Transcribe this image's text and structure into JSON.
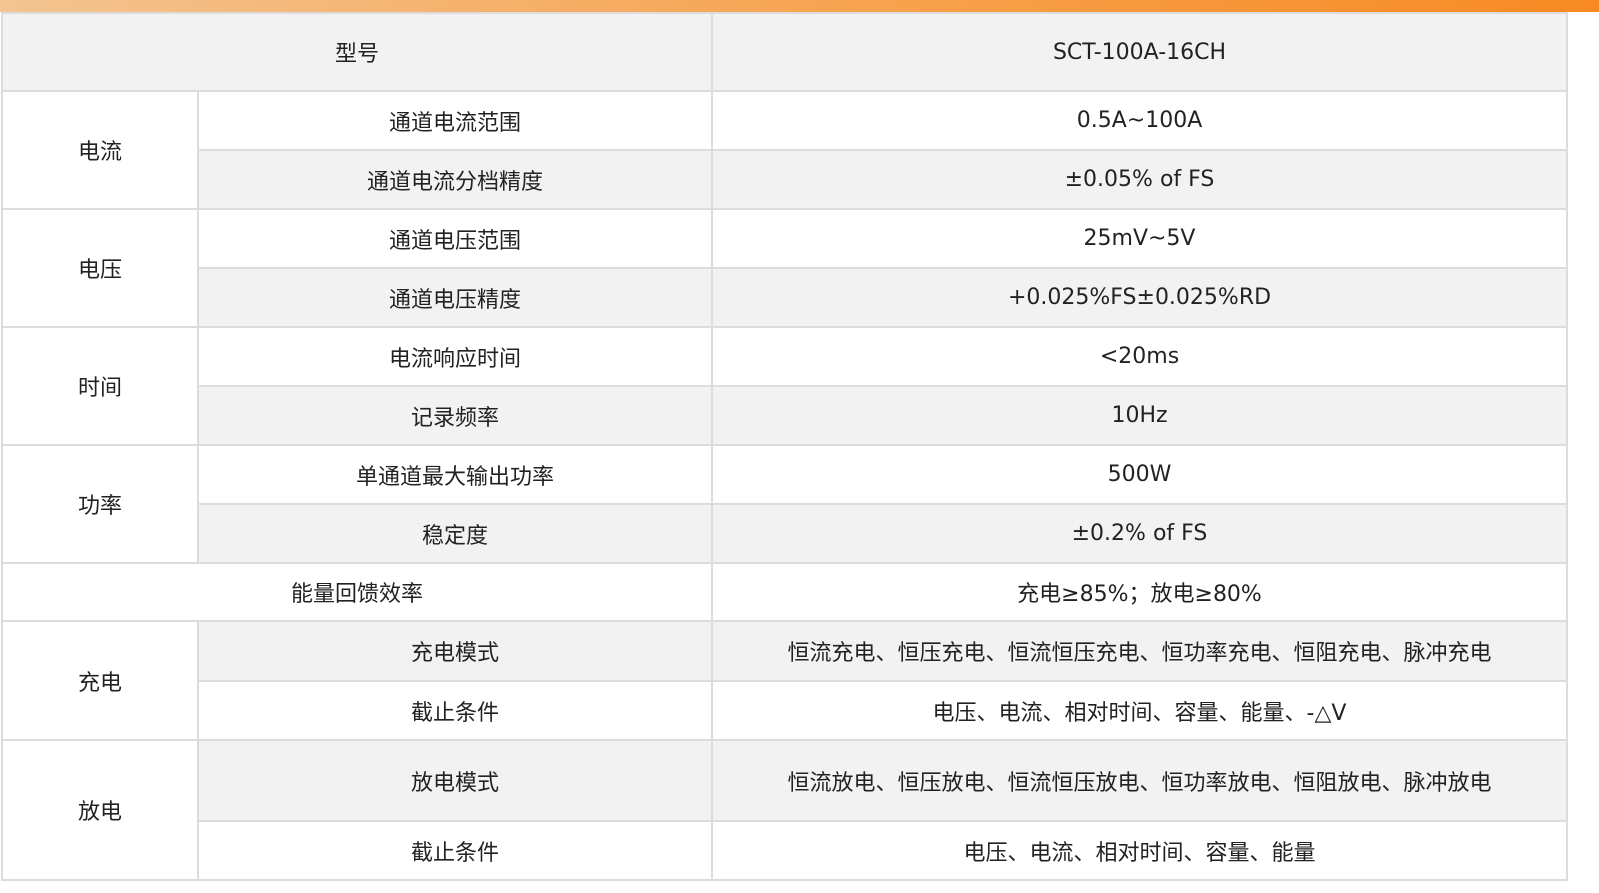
{
  "header": {
    "label": "型号",
    "value": "SCT-100A-16CH"
  },
  "groups": {
    "current": {
      "name": "电流",
      "rows": [
        {
          "label": "通道电流范围",
          "value": "0.5A~100A"
        },
        {
          "label": "通道电流分档精度",
          "value": "±0.05% of FS"
        }
      ]
    },
    "voltage": {
      "name": "电压",
      "rows": [
        {
          "label": "通道电压范围",
          "value": "25mV~5V"
        },
        {
          "label": "通道电压精度",
          "value": "+0.025%FS±0.025%RD"
        }
      ]
    },
    "time": {
      "name": "时间",
      "rows": [
        {
          "label": "电流响应时间",
          "value": "<20ms"
        },
        {
          "label": "记录频率",
          "value": "10Hz"
        }
      ]
    },
    "power": {
      "name": "功率",
      "rows": [
        {
          "label": "单通道最大输出功率",
          "value": "500W"
        },
        {
          "label": "稳定度",
          "value": "±0.2% of FS"
        }
      ]
    },
    "feedback": {
      "label": "能量回馈效率",
      "value": "充电≥85%；放电≥80%"
    },
    "charge": {
      "name": "充电",
      "rows": [
        {
          "label": "充电模式",
          "value": "恒流充电、恒压充电、恒流恒压充电、恒功率充电、恒阻充电、脉冲充电"
        },
        {
          "label": "截止条件",
          "value": "电压、电流、相对时间、容量、能量、-△V"
        }
      ]
    },
    "discharge": {
      "name": "放电",
      "rows": [
        {
          "label": "放电模式",
          "value": "恒流放电、恒压放电、恒流恒压放电、恒功率放电、恒阻放电、脉冲放电"
        },
        {
          "label": "截止条件",
          "value": "电压、电流、相对时间、容量、能量"
        }
      ]
    }
  },
  "colors": {
    "accent": "#f78a23",
    "row_grey": "#f2f2f2",
    "border": "#dcdcdc"
  }
}
